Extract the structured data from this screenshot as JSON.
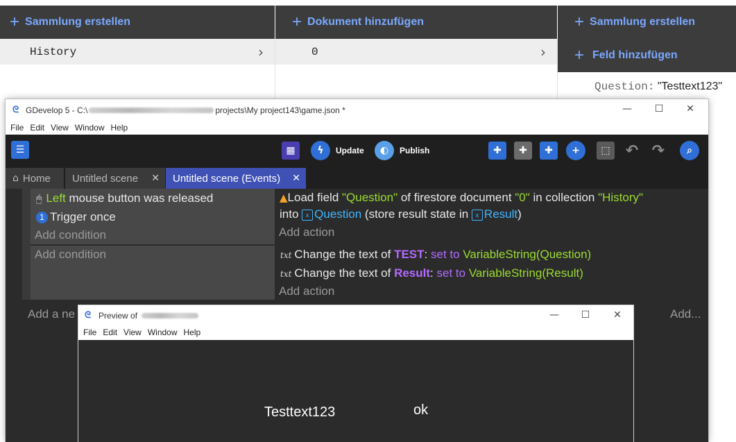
{
  "firestore": {
    "col1_header": "Sammlung erstellen",
    "col2_header": "Dokument hinzufügen",
    "col3_header": "Sammlung erstellen",
    "col3_add_field": "Feld hinzufügen",
    "collection_item": "History",
    "document_item": "0",
    "field_key": "Question:",
    "field_value": "\"Testtext123\"",
    "plus": "+",
    "chevron": "›"
  },
  "gdevelop": {
    "title_prefix": "GDevelop 5 - C:\\",
    "title_suffix": "projects\\My project143\\game.json *",
    "menu": [
      "File",
      "Edit",
      "View",
      "Window",
      "Help"
    ],
    "toolbar": {
      "update": "Update",
      "publish": "Publish"
    },
    "tabs": {
      "home": "Home",
      "scene": "Untitled scene",
      "events": "Untitled scene (Events)"
    },
    "events": {
      "cond_left": "Left",
      "cond_mouse_rest": " mouse button was released",
      "cond_trigger": "Trigger once",
      "add_condition": "Add condition",
      "add_action": "Add action",
      "act1_load": "Load field ",
      "act1_field": "\"Question\"",
      "act1_mid": " of firestore document ",
      "act1_doc": "\"0\"",
      "act1_mid2": " in collection ",
      "act1_coll": "\"History\"",
      "act1_into": "into ",
      "act1_var": "Question",
      "act1_store": " (store result state in ",
      "act1_result": "Result",
      "act1_close": ")",
      "act_change": "Change the text of ",
      "act_test": "TEST",
      "act_result_obj": "Result",
      "act_colon": ": ",
      "act_setto": "set to",
      "act_expr1": "VariableString(Question)",
      "act_expr2": "VariableString(Result)",
      "add_new": "Add a ne",
      "add_right": "Add..."
    }
  },
  "preview": {
    "title": "Preview of",
    "menu": [
      "File",
      "Edit",
      "View",
      "Window",
      "Help"
    ],
    "text_left": "Testtext123",
    "text_right": "ok"
  },
  "window_controls": {
    "minimize": "—",
    "maximize": "☐",
    "close": "✕"
  }
}
